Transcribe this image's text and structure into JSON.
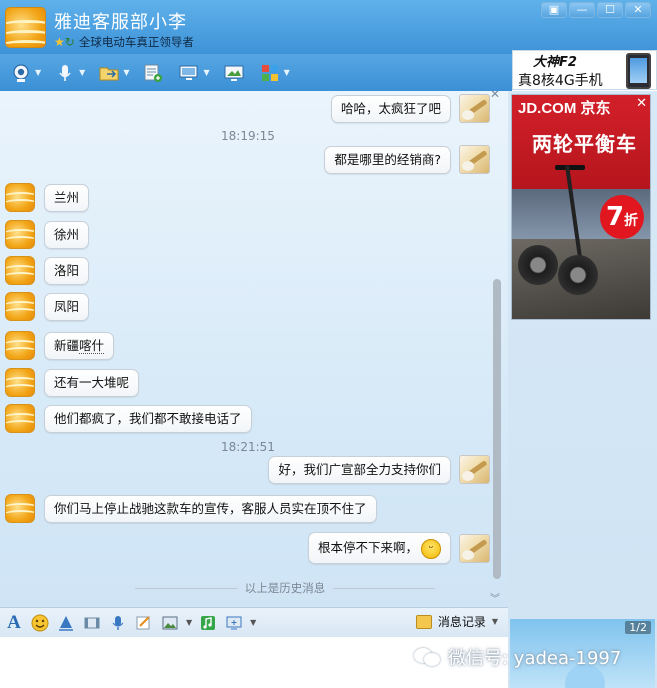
{
  "window": {
    "contact_name": "雅迪客服部小李",
    "contact_status": "全球电动车真正领导者",
    "controls": [
      "▣",
      "—",
      "☐",
      "✕"
    ]
  },
  "toolbar": {
    "items": [
      {
        "icon": "camera-icon"
      },
      {
        "icon": "microphone-icon"
      },
      {
        "icon": "folder-transfer-icon"
      },
      {
        "icon": "document-add-icon"
      },
      {
        "icon": "remote-desktop-icon"
      },
      {
        "icon": "share-screen-icon"
      },
      {
        "icon": "apps-grid-icon"
      }
    ]
  },
  "top_ad": {
    "brand": "大神F2",
    "slogan": "真8核4G手机"
  },
  "chat": {
    "messages": [
      {
        "side": "self",
        "text": "哈哈，太疯狂了吧"
      },
      {
        "type": "time",
        "text": "18:19:15"
      },
      {
        "side": "self",
        "text": "都是哪里的经销商?"
      },
      {
        "side": "other",
        "text": "兰州"
      },
      {
        "side": "other",
        "text": "徐州"
      },
      {
        "side": "other",
        "text": "洛阳"
      },
      {
        "side": "other",
        "text": "凤阳"
      },
      {
        "side": "other",
        "text": "新疆",
        "text_dotted": "喀什"
      },
      {
        "side": "other",
        "text": "还有一大堆呢"
      },
      {
        "side": "other",
        "text": "他们都疯了，我们都不敢接电话了"
      },
      {
        "type": "time",
        "text": "18:21:51"
      },
      {
        "side": "self",
        "text": "好，我们广宣部全力支持你们"
      },
      {
        "side": "other",
        "text": "你们马上停止战驰这款车的宣传，客服人员实在顶不住了"
      },
      {
        "side": "self",
        "text": "根本停不下来啊，",
        "emoji": "grin-emoji"
      }
    ],
    "history_label": "以上是历史消息"
  },
  "side_ad": {
    "logo": "JD.COM 京东",
    "close": "✕",
    "title": "两轮平衡车",
    "discount_number": "7",
    "discount_unit": "折"
  },
  "video_panel": {
    "page": "1/2"
  },
  "input_toolbar": {
    "font_label": "A",
    "history_button": "消息记录"
  },
  "watermark": {
    "text": "微信号: yadea-1997"
  },
  "colors": {
    "titlebar": "#4aa2e2",
    "chat_bg": "#dcecf8",
    "jd_red": "#d3202a"
  }
}
